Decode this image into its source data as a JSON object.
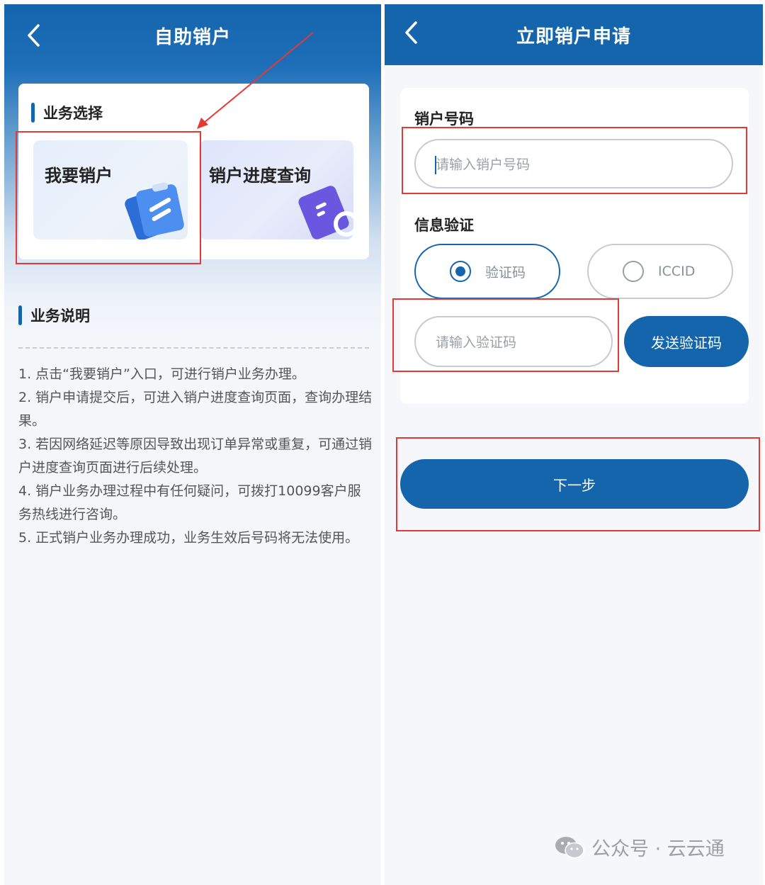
{
  "left": {
    "nav_title": "自助销户",
    "select_title": "业务选择",
    "tiles": [
      {
        "label": "我要销户"
      },
      {
        "label": "销户进度查询"
      }
    ],
    "desc_title": "业务说明",
    "desc_items": [
      "1. 点击“我要销户”入口，可进行销户业务办理。",
      "2. 销户申请提交后，可进入销户进度查询页面，查询办理结果。",
      "3. 若因网络延迟等原因导致出现订单异常或重复，可通过销户进度查询页面进行后续处理。",
      "4. 销户业务办理过程中有任何疑问，可拨打10099客户服务热线进行咨询。",
      "5. 正式销户业务办理成功，业务生效后号码将无法使用。"
    ]
  },
  "right": {
    "nav_title": "立即销户申请",
    "account_label": "销户号码",
    "account_placeholder": "请输入销户号码",
    "verify_label": "信息验证",
    "options": [
      {
        "label": "验证码",
        "selected": true
      },
      {
        "label": "ICCID",
        "selected": false
      }
    ],
    "code_placeholder": "请输入验证码",
    "send_code_button": "发送验证码",
    "next_button": "下一步"
  },
  "watermark": "公众号 · 云云通",
  "colors": {
    "primary": "#1565ad",
    "annotation": "#e53935",
    "background": "#f4f6fa"
  }
}
